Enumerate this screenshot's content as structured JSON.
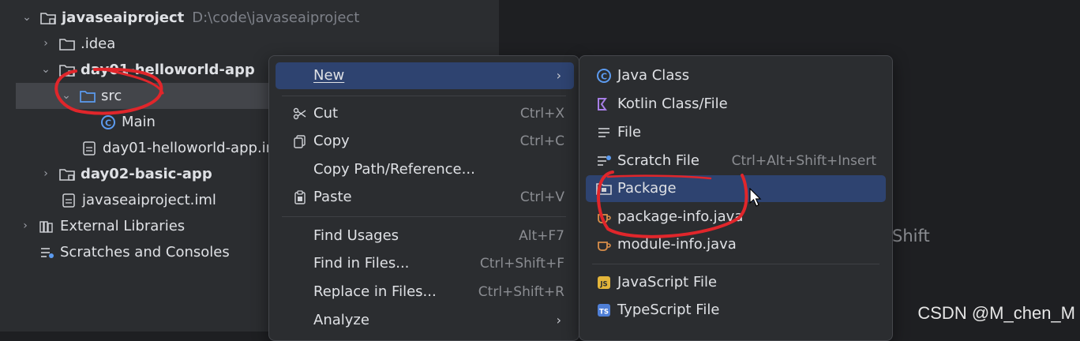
{
  "tree": {
    "items": [
      {
        "label": "javaseaiproject",
        "path": "D:\\code\\javaseaiproject"
      },
      {
        "label": ".idea"
      },
      {
        "label": "day01-helloworld-app"
      },
      {
        "label": "src"
      },
      {
        "label": "Main"
      },
      {
        "label": "day01-helloworld-app.im"
      },
      {
        "label": "day02-basic-app"
      },
      {
        "label": "javaseaiproject.iml"
      },
      {
        "label": "External Libraries"
      },
      {
        "label": "Scratches and Consoles"
      }
    ]
  },
  "context_menu": {
    "items": [
      {
        "label": "New",
        "shortcut": "",
        "submenu": true
      },
      {
        "label": "Cut",
        "shortcut": "Ctrl+X"
      },
      {
        "label": "Copy",
        "shortcut": "Ctrl+C"
      },
      {
        "label": "Copy Path/Reference...",
        "shortcut": ""
      },
      {
        "label": "Paste",
        "shortcut": "Ctrl+V"
      },
      {
        "label": "Find Usages",
        "shortcut": "Alt+F7"
      },
      {
        "label": "Find in Files...",
        "shortcut": "Ctrl+Shift+F"
      },
      {
        "label": "Replace in Files...",
        "shortcut": "Ctrl+Shift+R"
      },
      {
        "label": "Analyze",
        "shortcut": "",
        "submenu": true
      }
    ]
  },
  "new_submenu": {
    "items": [
      {
        "label": "Java Class",
        "shortcut": ""
      },
      {
        "label": "Kotlin Class/File",
        "shortcut": ""
      },
      {
        "label": "File",
        "shortcut": ""
      },
      {
        "label": "Scratch File",
        "shortcut": "Ctrl+Alt+Shift+Insert"
      },
      {
        "label": "Package",
        "shortcut": ""
      },
      {
        "label": "package-info.java",
        "shortcut": ""
      },
      {
        "label": "module-info.java",
        "shortcut": ""
      },
      {
        "label": "JavaScript File",
        "shortcut": ""
      },
      {
        "label": "TypeScript File",
        "shortcut": ""
      }
    ]
  },
  "editor": {
    "hint": "Shift"
  },
  "watermark": "CSDN @M_chen_M",
  "colors": {
    "highlight": "#2e4370",
    "annotation": "#e0262b",
    "selected_row": "#43454a"
  }
}
